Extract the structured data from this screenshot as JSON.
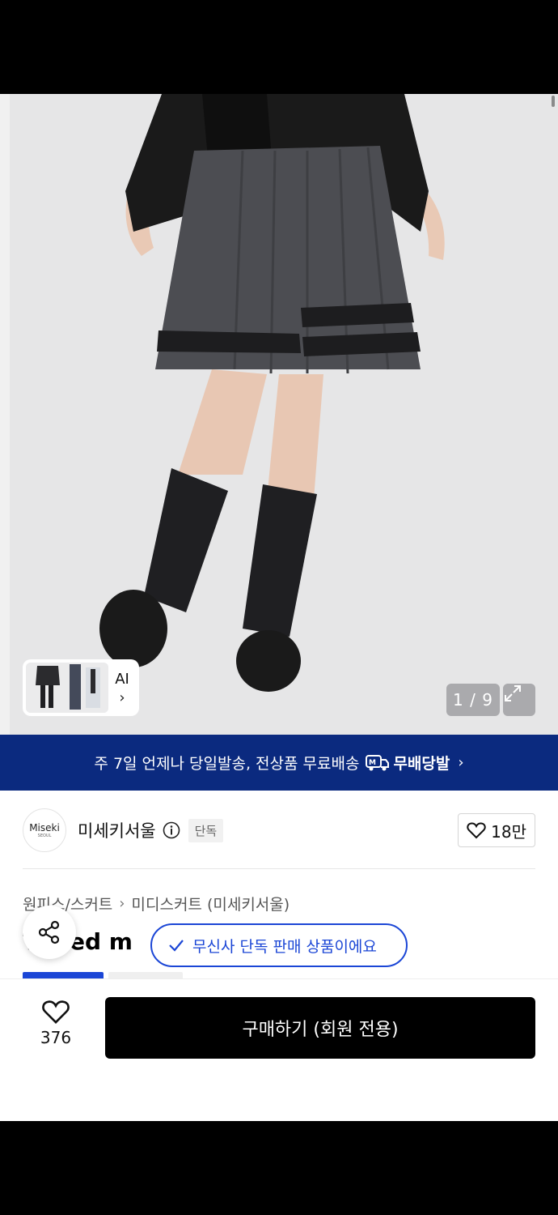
{
  "gallery": {
    "counter": "1 / 9",
    "ai_label": "AI",
    "expand_icon": "expand-icon"
  },
  "banner": {
    "text": "주 7일 언제나 당일발송, 전상품 무료배송",
    "logo_text": "무배당발",
    "chevron": "›"
  },
  "brand": {
    "logo_line1": "Miseki",
    "logo_line2": "SEOUL",
    "name": "미세키서울",
    "exclusive_badge": "단독",
    "like_count": "18만"
  },
  "breadcrumb": {
    "items": [
      "원피스/스커트",
      "미디스커트 (미세키서울)"
    ],
    "separator": "›"
  },
  "product": {
    "title_visible": "T   med m"
  },
  "toast": {
    "text": "무신사 단독 판매 상품이에요"
  },
  "action_bar": {
    "wish_count": "376",
    "buy_label": "구매하기 (회원 전용)"
  },
  "colors": {
    "banner_bg": "#0b2a7f",
    "accent_blue": "#1b46d6",
    "buy_bg": "#000000"
  }
}
